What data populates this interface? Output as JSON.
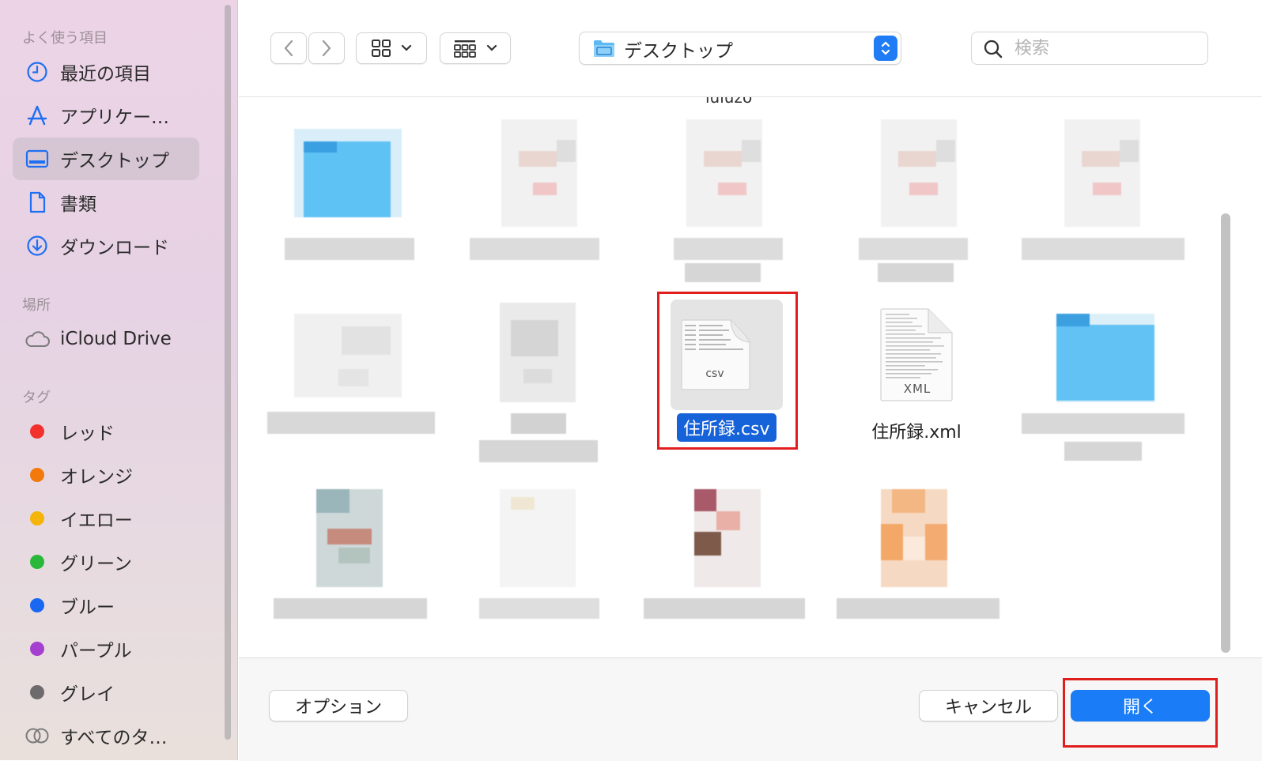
{
  "sidebar": {
    "sections": [
      {
        "label": "よく使う項目"
      },
      {
        "label": "場所"
      },
      {
        "label": "タグ"
      }
    ],
    "favorites": [
      {
        "label": "最近の項目",
        "icon": "clock-icon"
      },
      {
        "label": "アプリケー…",
        "icon": "applications-icon"
      },
      {
        "label": "デスクトップ",
        "icon": "desktop-icon",
        "selected": true
      },
      {
        "label": "書類",
        "icon": "document-icon"
      },
      {
        "label": "ダウンロード",
        "icon": "download-icon"
      }
    ],
    "locations": [
      {
        "label": "iCloud Drive",
        "icon": "cloud-icon"
      }
    ],
    "tags": [
      {
        "label": "レッド",
        "color": "#f2312d"
      },
      {
        "label": "オレンジ",
        "color": "#f27a0c"
      },
      {
        "label": "イエロー",
        "color": "#f4b40a"
      },
      {
        "label": "グリーン",
        "color": "#29b83a"
      },
      {
        "label": "ブルー",
        "color": "#1868f2"
      },
      {
        "label": "パープル",
        "color": "#a43fcf"
      },
      {
        "label": "グレイ",
        "color": "#6d6a6e"
      },
      {
        "label": "すべてのタ…",
        "icon": "all-tags-icon"
      }
    ]
  },
  "toolbar": {
    "location": "デスクトップ",
    "search_placeholder": "検索"
  },
  "files": {
    "cut_label": "iuiuzo",
    "selected_file": "住所録.csv",
    "selected_file_type": "csv",
    "xml_file": "住所録.xml",
    "xml_file_type": "XML"
  },
  "buttons": {
    "options": "オプション",
    "cancel": "キャンセル",
    "open": "開く"
  },
  "colors": {
    "accent": "#1a7cf6",
    "highlight": "#e01e1e",
    "folder": "#6cc4f5"
  }
}
